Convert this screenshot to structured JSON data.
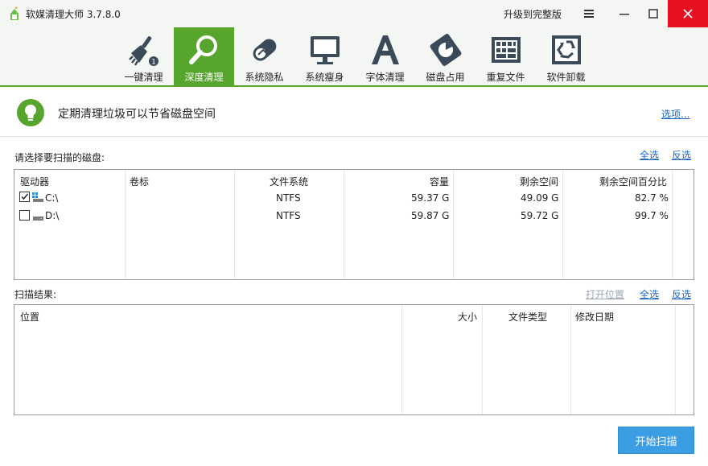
{
  "app": {
    "title": "软媒清理大师 3.7.8.0",
    "upgrade_label": "升级到完整版",
    "accent_color": "#58a52e",
    "close_color": "#e81123"
  },
  "window_controls": [
    "menu-icon",
    "minimize-icon",
    "maximize-icon",
    "close-icon"
  ],
  "toolbar": {
    "active_index": 1,
    "items": [
      {
        "label": "一键清理",
        "icon": "broom-icon",
        "badge": "1"
      },
      {
        "label": "深度清理",
        "icon": "magnifier-icon"
      },
      {
        "label": "系统隐私",
        "icon": "privacy-capsule-icon"
      },
      {
        "label": "系统瘦身",
        "icon": "monitor-icon"
      },
      {
        "label": "字体清理",
        "icon": "font-icon"
      },
      {
        "label": "磁盘占用",
        "icon": "disk-pie-icon"
      },
      {
        "label": "重复文件",
        "icon": "duplicate-grid-icon"
      },
      {
        "label": "软件卸载",
        "icon": "recycle-icon"
      }
    ]
  },
  "tip": {
    "text": "定期清理垃圾可以节省磁盘空间",
    "options_link": "选项..."
  },
  "drives": {
    "section_label": "请选择要扫描的磁盘:",
    "select_all": "全选",
    "invert": "反选",
    "columns": [
      "驱动器",
      "卷标",
      "文件系统",
      "容量",
      "剩余空间",
      "剩余空间百分比"
    ],
    "rows": [
      {
        "checked": true,
        "drive": "C:\\",
        "label": "",
        "fs": "NTFS",
        "capacity": "59.37 G",
        "free": "49.09 G",
        "free_pct": "82.7 %"
      },
      {
        "checked": false,
        "drive": "D:\\",
        "label": "",
        "fs": "NTFS",
        "capacity": "59.87 G",
        "free": "59.72 G",
        "free_pct": "99.7 %"
      }
    ]
  },
  "results": {
    "section_label": "扫描结果:",
    "open_location": "打开位置",
    "select_all": "全选",
    "invert": "反选",
    "columns": [
      "位置",
      "大小",
      "文件类型",
      "修改日期"
    ]
  },
  "start_button": "开始扫描"
}
